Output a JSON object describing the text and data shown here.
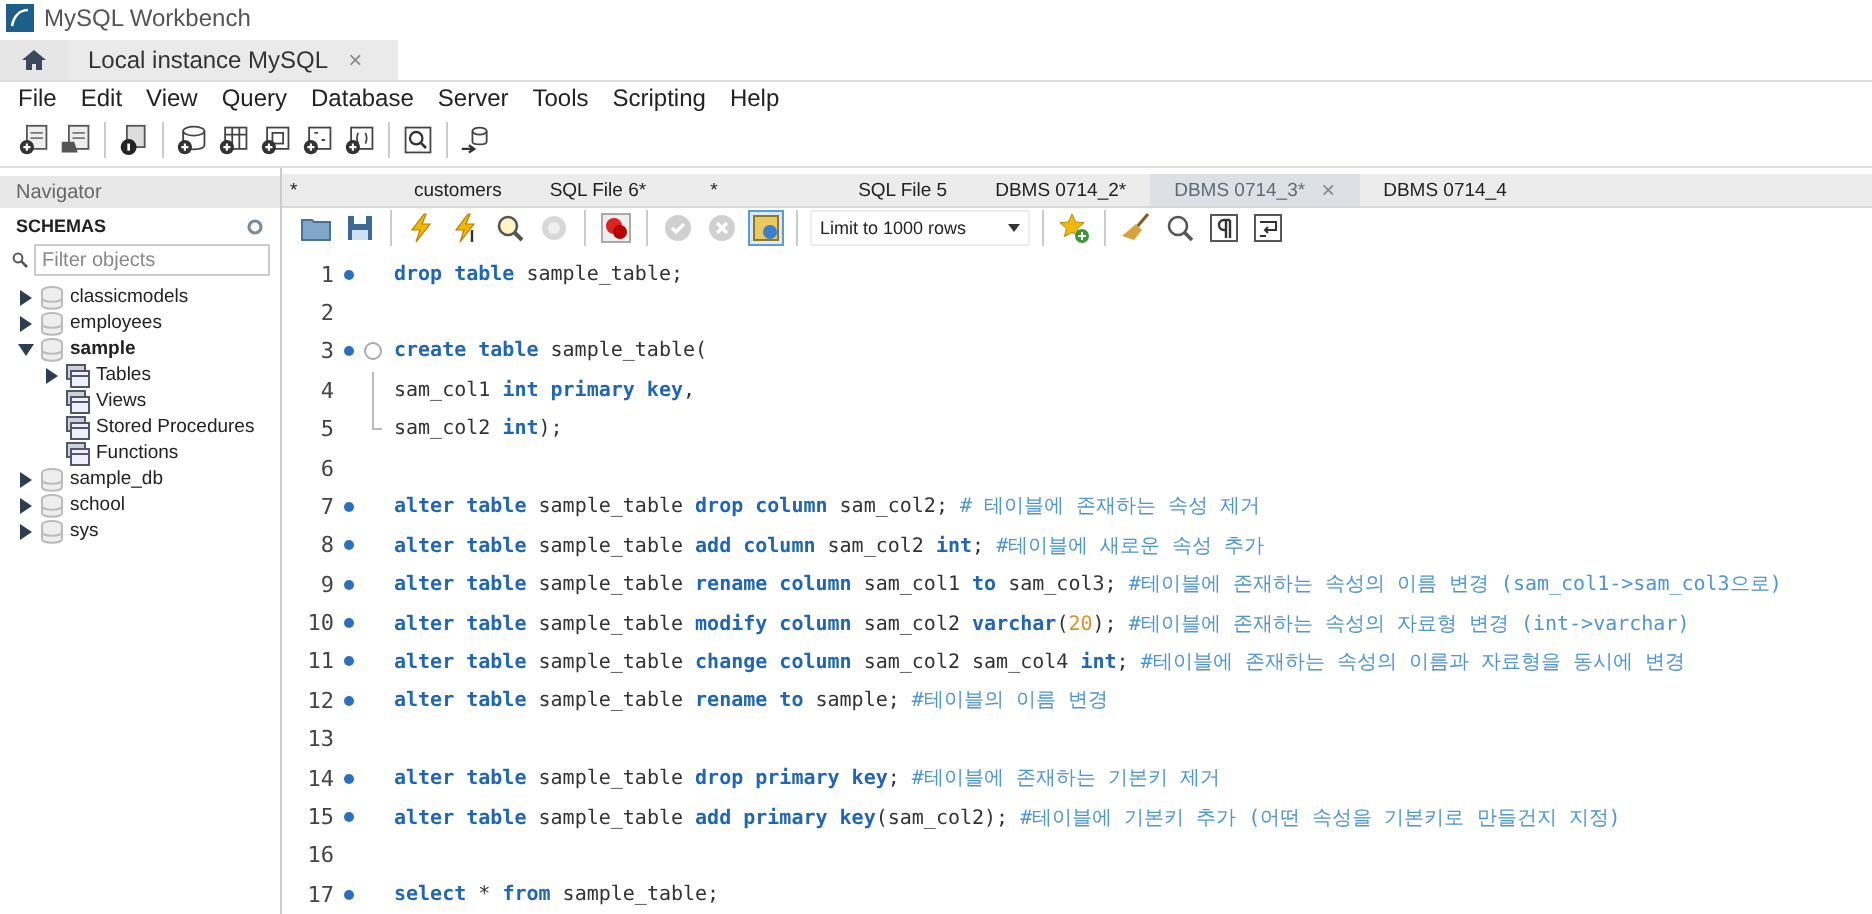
{
  "window": {
    "title": "MySQL Workbench"
  },
  "connection_tabs": [
    {
      "label": "Local instance MySQL",
      "close": "×",
      "selected": true
    }
  ],
  "menu": [
    "File",
    "Edit",
    "View",
    "Query",
    "Database",
    "Server",
    "Tools",
    "Scripting",
    "Help"
  ],
  "navigator": {
    "title": "Navigator",
    "section": "SCHEMAS",
    "filter": {
      "placeholder": "Filter objects"
    },
    "tree": [
      {
        "label": "classicmodels",
        "kind": "schema",
        "active": false,
        "expanded": false
      },
      {
        "label": "employees",
        "kind": "schema",
        "active": false,
        "expanded": false
      },
      {
        "label": "sample",
        "kind": "schema",
        "active": true,
        "expanded": true,
        "children": [
          {
            "label": "Tables",
            "kind": "folder",
            "active": false,
            "expanded": false
          },
          {
            "label": "Views",
            "kind": "folder",
            "active": false
          },
          {
            "label": "Stored Procedures",
            "kind": "folder",
            "active": false
          },
          {
            "label": "Functions",
            "kind": "folder",
            "active": false
          }
        ]
      },
      {
        "label": "sample_db",
        "kind": "schema",
        "active": false,
        "expanded": false
      },
      {
        "label": "school",
        "kind": "schema",
        "active": false,
        "expanded": false
      },
      {
        "label": "sys",
        "kind": "schema",
        "active": false,
        "expanded": false
      }
    ]
  },
  "editor_tabs": [
    {
      "label": "*",
      "selected": false
    },
    {
      "label": "customers",
      "selected": false
    },
    {
      "label": "SQL File 6*",
      "selected": false
    },
    {
      "label": "*",
      "selected": false
    },
    {
      "label": "SQL File 5",
      "selected": false
    },
    {
      "label": "DBMS 0714_2*",
      "selected": false
    },
    {
      "label": "DBMS 0714_3*",
      "selected": true,
      "close": "×"
    },
    {
      "label": "DBMS 0714_4",
      "selected": false
    }
  ],
  "editor_toolbar": [
    {
      "kind": "open",
      "disabled": false,
      "selected": false
    },
    {
      "kind": "save",
      "disabled": false,
      "selected": false
    },
    {
      "kind": "sep"
    },
    {
      "kind": "execute",
      "disabled": false,
      "selected": false
    },
    {
      "kind": "execute-line",
      "disabled": false,
      "selected": false
    },
    {
      "kind": "explain",
      "disabled": false,
      "selected": false
    },
    {
      "kind": "stop",
      "disabled": true,
      "selected": false
    },
    {
      "kind": "sep"
    },
    {
      "kind": "error-toggle",
      "disabled": false,
      "selected": false
    },
    {
      "kind": "sep"
    },
    {
      "kind": "commit",
      "disabled": true,
      "selected": false
    },
    {
      "kind": "rollback",
      "disabled": true,
      "selected": false
    },
    {
      "kind": "autocommit",
      "disabled": false,
      "selected": true
    },
    {
      "kind": "sep"
    },
    {
      "kind": "limit",
      "label": "Limit to 1000 rows"
    },
    {
      "kind": "sep"
    },
    {
      "kind": "snippet",
      "disabled": false,
      "selected": false
    },
    {
      "kind": "sep"
    },
    {
      "kind": "beautify",
      "disabled": false,
      "selected": false
    },
    {
      "kind": "find",
      "disabled": false,
      "selected": false
    },
    {
      "kind": "invisibles",
      "disabled": false,
      "selected": false
    },
    {
      "kind": "wrap",
      "disabled": false,
      "selected": false
    }
  ],
  "code_lines": [
    {
      "number": "1",
      "statement": true,
      "fold_start": false,
      "in_fold": false,
      "tokens": [
        {
          "kind": "keyword",
          "text": "drop table"
        },
        {
          "kind": "plain",
          "text": " sample_table;"
        }
      ]
    },
    {
      "number": "2",
      "statement": false,
      "fold_start": false,
      "in_fold": false
    },
    {
      "number": "3",
      "statement": true,
      "fold_start": true,
      "in_fold": false,
      "tokens": [
        {
          "kind": "keyword",
          "text": "create table"
        },
        {
          "kind": "plain",
          "text": " sample_table("
        }
      ]
    },
    {
      "number": "4",
      "statement": false,
      "fold_start": false,
      "in_fold": true,
      "tokens": [
        {
          "kind": "plain",
          "text": "sam_col1 "
        },
        {
          "kind": "keyword",
          "text": "int primary key"
        },
        {
          "kind": "plain",
          "text": ","
        }
      ]
    },
    {
      "number": "5",
      "statement": false,
      "fold_start": false,
      "in_fold": true,
      "tokens": [
        {
          "kind": "plain",
          "text": "sam_col2 "
        },
        {
          "kind": "keyword",
          "text": "int"
        },
        {
          "kind": "plain",
          "text": ");"
        }
      ]
    },
    {
      "number": "6",
      "statement": false,
      "fold_start": false,
      "in_fold": false
    },
    {
      "number": "7",
      "statement": true,
      "fold_start": false,
      "in_fold": false,
      "tokens": [
        {
          "kind": "keyword",
          "text": "alter table"
        },
        {
          "kind": "plain",
          "text": " sample_table "
        },
        {
          "kind": "keyword",
          "text": "drop column"
        },
        {
          "kind": "plain",
          "text": " sam_col2; "
        },
        {
          "kind": "comment",
          "text": "# 테이블에 존재하는 속성 제거"
        }
      ]
    },
    {
      "number": "8",
      "statement": true,
      "fold_start": false,
      "in_fold": false,
      "tokens": [
        {
          "kind": "keyword",
          "text": "alter table"
        },
        {
          "kind": "plain",
          "text": " sample_table "
        },
        {
          "kind": "keyword",
          "text": "add column"
        },
        {
          "kind": "plain",
          "text": " sam_col2 "
        },
        {
          "kind": "keyword",
          "text": "int"
        },
        {
          "kind": "plain",
          "text": "; "
        },
        {
          "kind": "comment",
          "text": "#테이블에 새로운 속성 추가"
        }
      ]
    },
    {
      "number": "9",
      "statement": true,
      "fold_start": false,
      "in_fold": false,
      "tokens": [
        {
          "kind": "keyword",
          "text": "alter table"
        },
        {
          "kind": "plain",
          "text": " sample_table "
        },
        {
          "kind": "keyword",
          "text": "rename column"
        },
        {
          "kind": "plain",
          "text": " sam_col1 "
        },
        {
          "kind": "keyword",
          "text": "to"
        },
        {
          "kind": "plain",
          "text": " sam_col3; "
        },
        {
          "kind": "comment",
          "text": "#테이블에 존재하는 속성의 이름 변경 (sam_col1->sam_col3으로)"
        }
      ]
    },
    {
      "number": "10",
      "statement": true,
      "fold_start": false,
      "in_fold": false,
      "tokens": [
        {
          "kind": "keyword",
          "text": "alter table"
        },
        {
          "kind": "plain",
          "text": " sample_table "
        },
        {
          "kind": "keyword",
          "text": "modify column"
        },
        {
          "kind": "plain",
          "text": " sam_col2 "
        },
        {
          "kind": "keyword",
          "text": "varchar"
        },
        {
          "kind": "plain",
          "text": "("
        },
        {
          "kind": "number",
          "text": "20"
        },
        {
          "kind": "plain",
          "text": "); "
        },
        {
          "kind": "comment",
          "text": "#테이블에 존재하는 속성의 자료형 변경 (int->varchar)"
        }
      ]
    },
    {
      "number": "11",
      "statement": true,
      "fold_start": false,
      "in_fold": false,
      "tokens": [
        {
          "kind": "keyword",
          "text": "alter table"
        },
        {
          "kind": "plain",
          "text": " sample_table "
        },
        {
          "kind": "keyword",
          "text": "change column"
        },
        {
          "kind": "plain",
          "text": " sam_col2 sam_col4 "
        },
        {
          "kind": "keyword",
          "text": "int"
        },
        {
          "kind": "plain",
          "text": "; "
        },
        {
          "kind": "comment",
          "text": "#테이블에 존재하는 속성의 이름과 자료형을 동시에 변경"
        }
      ]
    },
    {
      "number": "12",
      "statement": true,
      "fold_start": false,
      "in_fold": false,
      "tokens": [
        {
          "kind": "keyword",
          "text": "alter table"
        },
        {
          "kind": "plain",
          "text": " sample_table "
        },
        {
          "kind": "keyword",
          "text": "rename to"
        },
        {
          "kind": "plain",
          "text": " sample; "
        },
        {
          "kind": "comment",
          "text": "#테이블의 이름 변경"
        }
      ]
    },
    {
      "number": "13",
      "statement": false,
      "fold_start": false,
      "in_fold": false
    },
    {
      "number": "14",
      "statement": true,
      "fold_start": false,
      "in_fold": false,
      "tokens": [
        {
          "kind": "keyword",
          "text": "alter table"
        },
        {
          "kind": "plain",
          "text": " sample_table "
        },
        {
          "kind": "keyword",
          "text": "drop primary key"
        },
        {
          "kind": "plain",
          "text": "; "
        },
        {
          "kind": "comment",
          "text": "#테이블에 존재하는 기본키 제거"
        }
      ]
    },
    {
      "number": "15",
      "statement": true,
      "fold_start": false,
      "in_fold": false,
      "tokens": [
        {
          "kind": "keyword",
          "text": "alter table"
        },
        {
          "kind": "plain",
          "text": " sample_table "
        },
        {
          "kind": "keyword",
          "text": "add primary key"
        },
        {
          "kind": "plain",
          "text": "(sam_col2); "
        },
        {
          "kind": "comment",
          "text": "#테이블에 기본키 추가 (어떤 속성을 기본키로 만들건지 지정)"
        }
      ]
    },
    {
      "number": "16",
      "statement": false,
      "fold_start": false,
      "in_fold": false
    },
    {
      "number": "17",
      "statement": true,
      "fold_start": false,
      "in_fold": false,
      "tokens": [
        {
          "kind": "keyword",
          "text": "select"
        },
        {
          "kind": "plain",
          "text": " * "
        },
        {
          "kind": "keyword",
          "text": "from"
        },
        {
          "kind": "plain",
          "text": " sample_table;"
        }
      ]
    }
  ]
}
